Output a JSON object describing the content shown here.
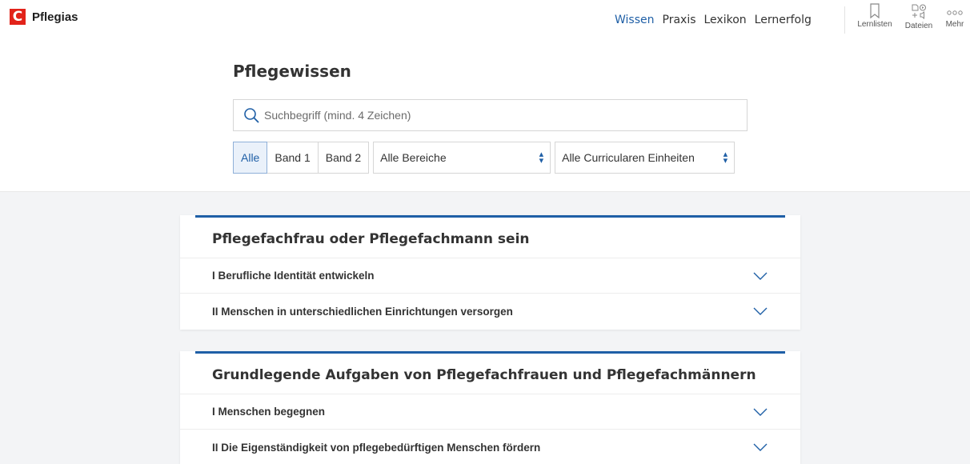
{
  "brand": {
    "logo_letter": "C",
    "name": "Pflegias"
  },
  "nav": {
    "items": [
      {
        "label": "Wissen",
        "active": true
      },
      {
        "label": "Praxis",
        "active": false
      },
      {
        "label": "Lexikon",
        "active": false
      },
      {
        "label": "Lernerfolg",
        "active": false
      }
    ]
  },
  "tools": {
    "lernlisten": {
      "label": "Lernlisten",
      "icon": "bookmark-icon"
    },
    "dateien": {
      "label": "Dateien",
      "icon": "files-icon"
    },
    "mehr": {
      "label": "Mehr",
      "icon": "more-icon"
    }
  },
  "page": {
    "title": "Pflegewissen",
    "search": {
      "placeholder": "Suchbegriff (mind. 4 Zeichen)",
      "value": ""
    },
    "filters": {
      "segments": [
        {
          "label": "Alle",
          "active": true
        },
        {
          "label": "Band 1",
          "active": false
        },
        {
          "label": "Band 2",
          "active": false
        }
      ],
      "bereiche": "Alle Bereiche",
      "curricular": "Alle Curricularen Einheiten"
    }
  },
  "cards": [
    {
      "title": "Pflegefachfrau oder Pflegefachmann sein",
      "rows": [
        "I Berufliche Identität entwickeln",
        "II Menschen in unterschiedlichen Einrichtungen versorgen"
      ]
    },
    {
      "title": "Grundlegende Aufgaben von Pflegefachfrauen und Pflegefachmännern",
      "rows": [
        "I Menschen begegnen",
        "II Die Eigenständigkeit von pflegebedürftigen Menschen fördern"
      ]
    }
  ],
  "colors": {
    "accent": "#1f5fa6",
    "brand": "#e2231a"
  }
}
